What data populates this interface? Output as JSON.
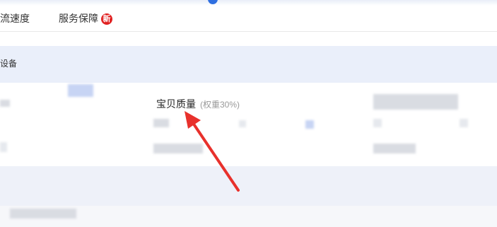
{
  "tabs": {
    "logistics_label": "物流速度",
    "service_label": "服务保障",
    "new_badge": "新"
  },
  "section": {
    "title_fragment": "设备"
  },
  "metric": {
    "label": "宝贝质量",
    "weight": "(权重30%)"
  },
  "colors": {
    "accent_blue": "#2f6fe0",
    "badge_red": "#e02020",
    "arrow_red": "#e8312c",
    "section_band": "#eaeffa"
  }
}
